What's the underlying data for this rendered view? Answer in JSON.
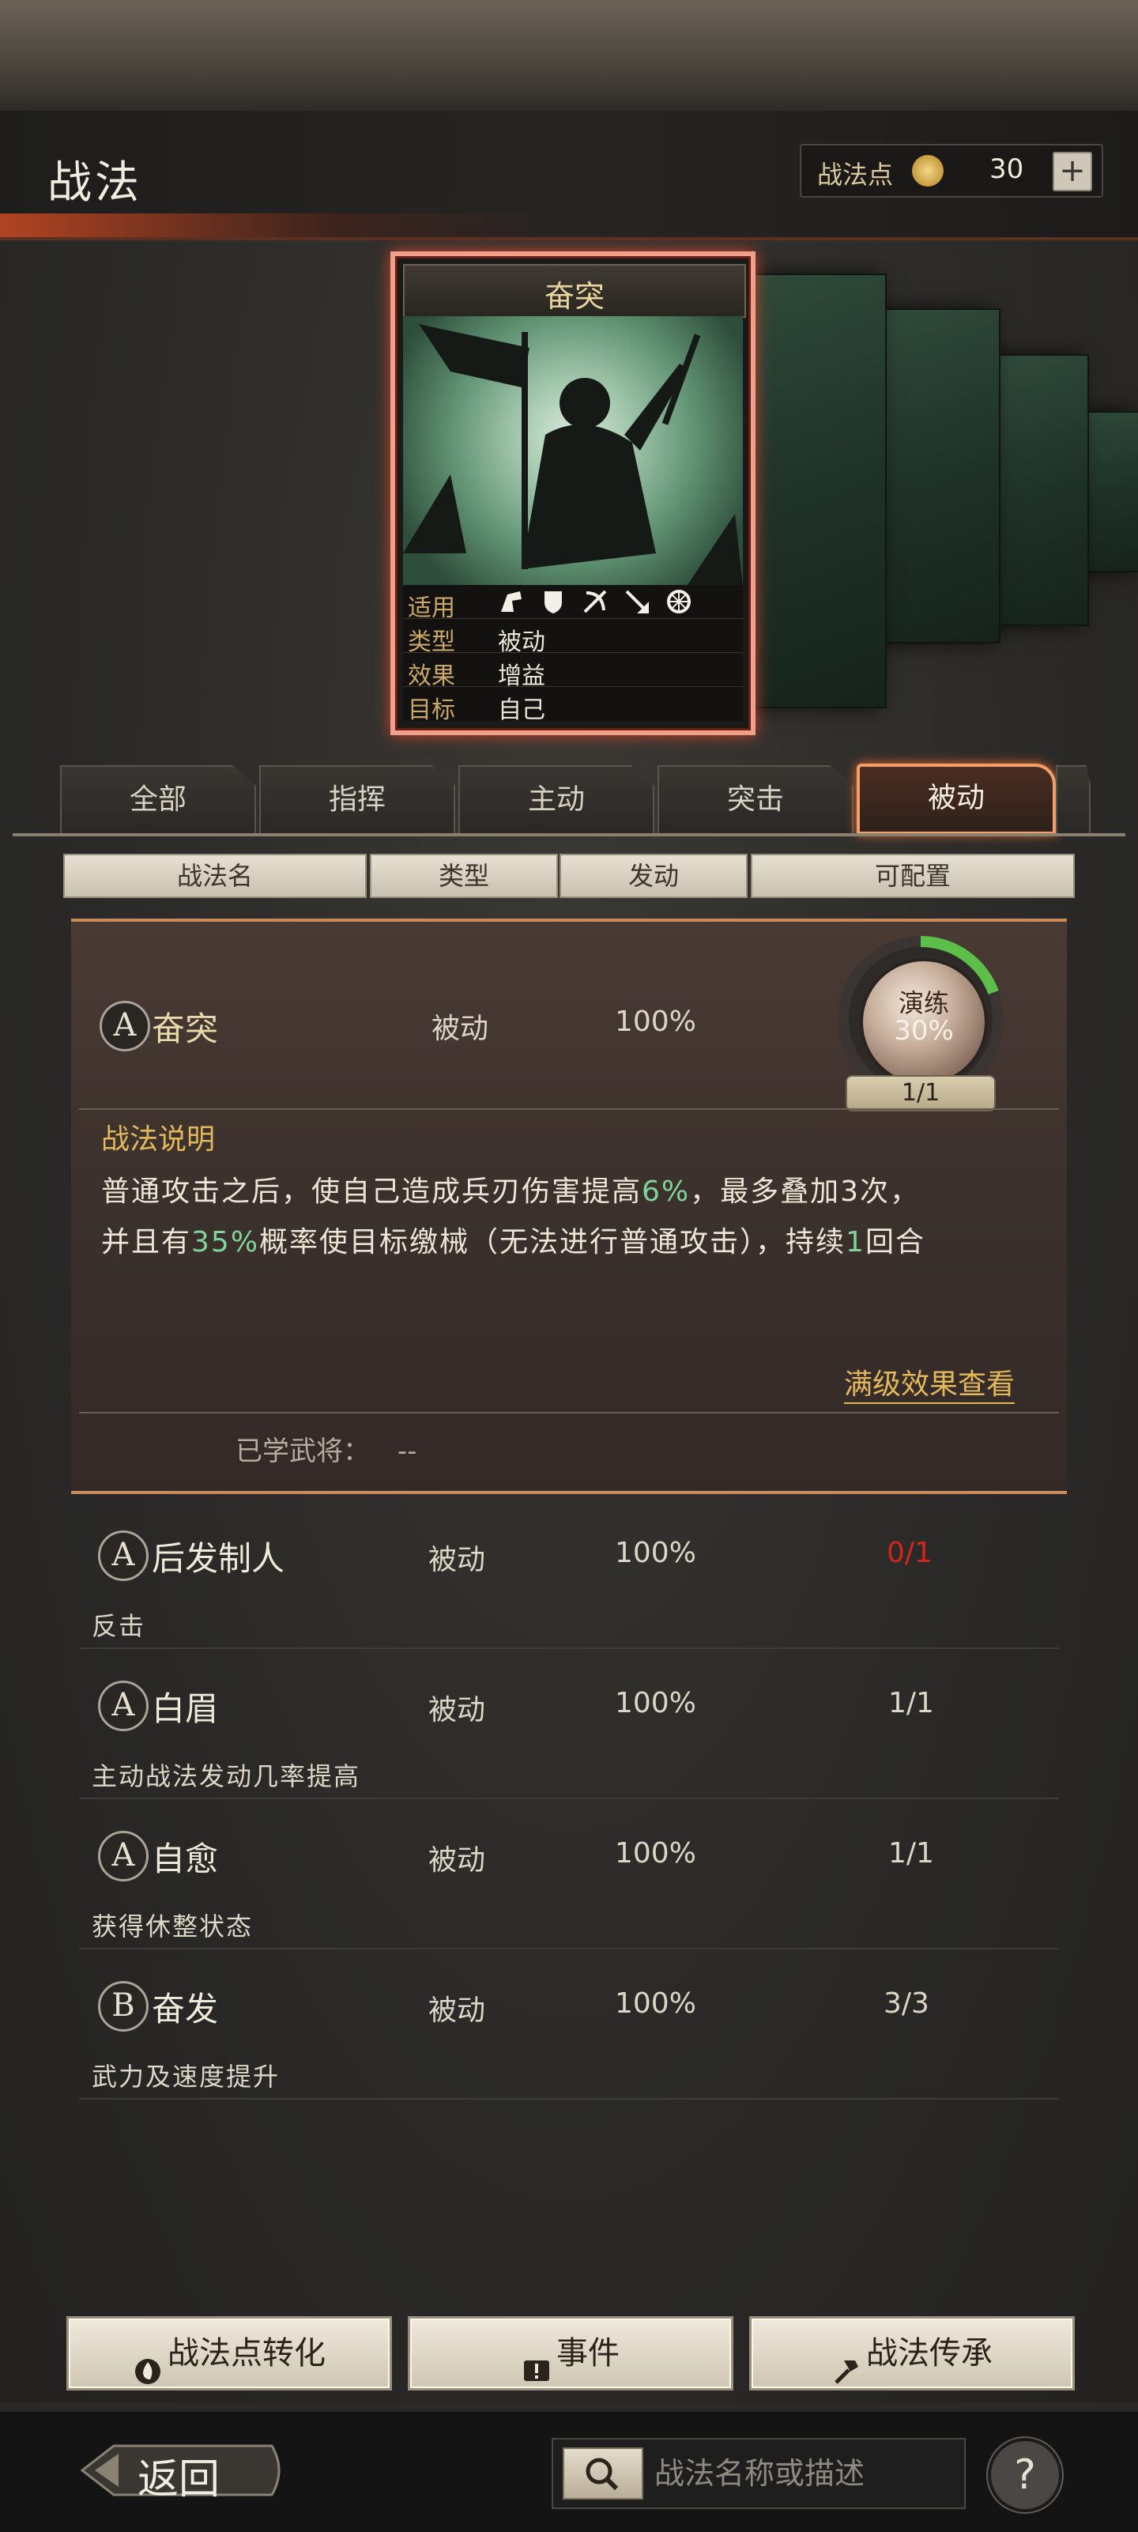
{
  "header": {
    "title": "战法",
    "points_label": "战法点",
    "points_value": "30",
    "points_plus": "+"
  },
  "card": {
    "name": "奋突",
    "applicable_label": "适用",
    "type_label": "类型",
    "type_value": "被动",
    "effect_label": "效果",
    "effect_value": "增益",
    "target_label": "目标",
    "target_value": "自己",
    "unit_icons": [
      "cavalry-icon",
      "shield-icon",
      "bow-icon",
      "spear-icon",
      "chariot-icon"
    ]
  },
  "tabs": [
    {
      "label": "全部"
    },
    {
      "label": "指挥"
    },
    {
      "label": "主动"
    },
    {
      "label": "突击"
    },
    {
      "label": "被动"
    }
  ],
  "columns": [
    "战法名",
    "类型",
    "发动",
    "可配置"
  ],
  "selected": {
    "grade": "A",
    "name": "奋突",
    "type": "被动",
    "rate": "100%",
    "train_label": "演练",
    "train_progress": "30%",
    "configurable": "1/1",
    "desc_title": "战法说明",
    "desc_line1_a": "普通攻击之后，使自己造成兵刃伤害提高",
    "desc_line1_b": "6%",
    "desc_line1_c": "，最多叠加3次，",
    "desc_line2_a": "并且有",
    "desc_line2_b": "35%",
    "desc_line2_c": "概率使目标缴械（无法进行普通攻击），持续",
    "desc_line2_d": "1",
    "desc_line2_e": "回合",
    "full_effect_link": "满级效果查看",
    "learned_label": "已学武将：",
    "learned_value": "--"
  },
  "skills": [
    {
      "grade": "A",
      "name": "后发制人",
      "type": "被动",
      "rate": "100%",
      "configurable": "0/1",
      "desc": "反击"
    },
    {
      "grade": "A",
      "name": "白眉",
      "type": "被动",
      "rate": "100%",
      "configurable": "1/1",
      "desc": "主动战法发动几率提高"
    },
    {
      "grade": "A",
      "name": "自愈",
      "type": "被动",
      "rate": "100%",
      "configurable": "1/1",
      "desc": "获得休整状态"
    },
    {
      "grade": "B",
      "name": "奋发",
      "type": "被动",
      "rate": "100%",
      "configurable": "3/3",
      "desc": "武力及速度提升"
    }
  ],
  "bottom_buttons": {
    "convert": "战法点转化",
    "event": "事件",
    "inherit": "战法传承"
  },
  "footer": {
    "back": "返回",
    "search_placeholder": "战法名称或描述",
    "help": "?"
  },
  "colors": {
    "accent_orange": "#f2a06a",
    "gold": "#e2b85a",
    "highlight_green": "#7fd49a",
    "warning_red": "#d2261c"
  }
}
